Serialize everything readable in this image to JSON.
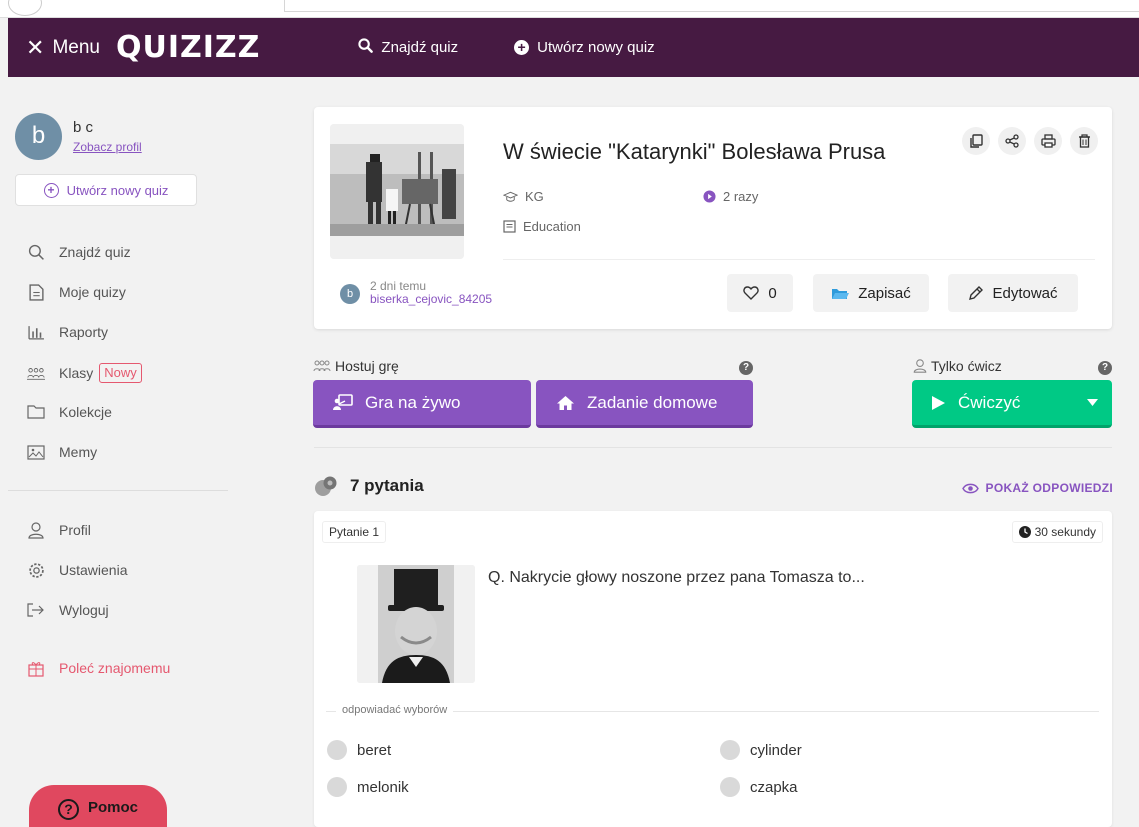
{
  "header": {
    "menu_label": "Menu",
    "logo": "QUIZIZZ",
    "find_quiz": "Znajdź quiz",
    "create_quiz": "Utwórz nowy quiz"
  },
  "sidebar": {
    "avatar_letter": "b",
    "user_name": "b c",
    "profile_link": "Zobacz profil",
    "create_button": "Utwórz nowy quiz",
    "items": [
      {
        "label": "Znajdź quiz",
        "icon": "search-icon"
      },
      {
        "label": "Moje quizy",
        "icon": "document-icon"
      },
      {
        "label": "Raporty",
        "icon": "bar-chart-icon"
      },
      {
        "label": "Klasy",
        "icon": "classes-icon",
        "badge": "Nowy"
      },
      {
        "label": "Kolekcje",
        "icon": "folder-icon"
      },
      {
        "label": "Memy",
        "icon": "image-icon"
      },
      {
        "label": "Profil",
        "icon": "user-icon"
      },
      {
        "label": "Ustawienia",
        "icon": "gear-icon"
      },
      {
        "label": "Wyloguj",
        "icon": "logout-icon"
      },
      {
        "label": "Poleć znajomemu",
        "icon": "gift-icon"
      }
    ],
    "help_button": "Pomoc"
  },
  "quiz": {
    "title": "W świecie \"Katarynki\" Bolesława Prusa",
    "grade": "KG",
    "subject": "Education",
    "plays": "2 razy",
    "author_avatar": "b",
    "author_time": "2 dni temu",
    "author_name": "biserka_cejovic_84205",
    "likes": "0",
    "save_label": "Zapisać",
    "edit_label": "Edytować"
  },
  "host": {
    "label": "Hostuj grę",
    "live_button": "Gra na żywo",
    "homework_button": "Zadanie domowe"
  },
  "practice": {
    "label": "Tylko ćwicz",
    "button": "Ćwiczyć"
  },
  "questions": {
    "count_label": "7 pytania",
    "show_answers": "POKAŻ ODPOWIEDZI",
    "items": [
      {
        "tag": "Pytanie 1",
        "time": "30 sekundy",
        "text": "Q. Nakrycie głowy noszone przez pana Tomasza to...",
        "options_label": "odpowiadać wyborów",
        "options": [
          "beret",
          "cylinder",
          "melonik",
          "czapka"
        ]
      }
    ]
  },
  "colors": {
    "header_bg": "#461a42",
    "accent_purple": "#8854c0",
    "practice_green": "#00c985",
    "help_red": "#e0485f"
  }
}
